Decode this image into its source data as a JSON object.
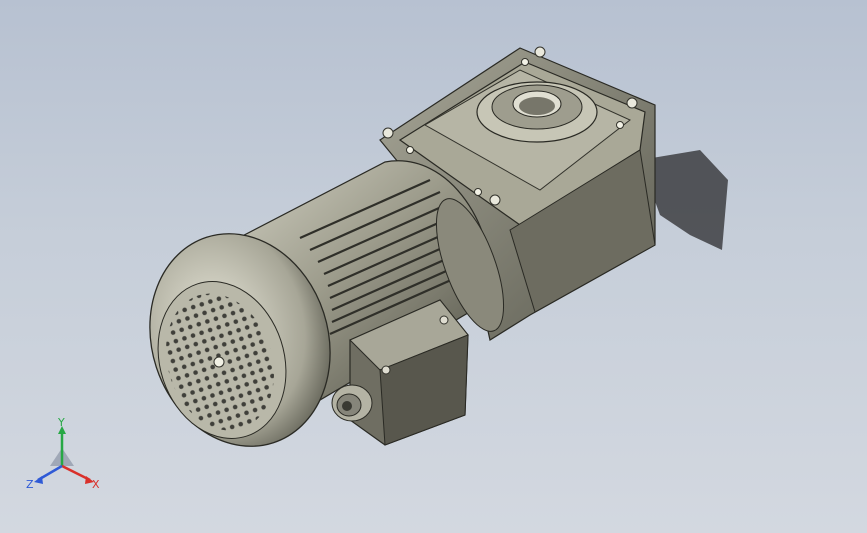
{
  "viewport": {
    "colors": {
      "metal_dark": "#4f4f44",
      "metal_mid": "#8e8d7e",
      "metal_light": "#c9c8b8",
      "shadow": "#2b2b2e"
    }
  },
  "triad": {
    "x_label": "X",
    "y_label": "Y",
    "z_label": "Z",
    "colors": {
      "x": "#d9302b",
      "y": "#27a845",
      "z": "#2f5ad6"
    }
  }
}
